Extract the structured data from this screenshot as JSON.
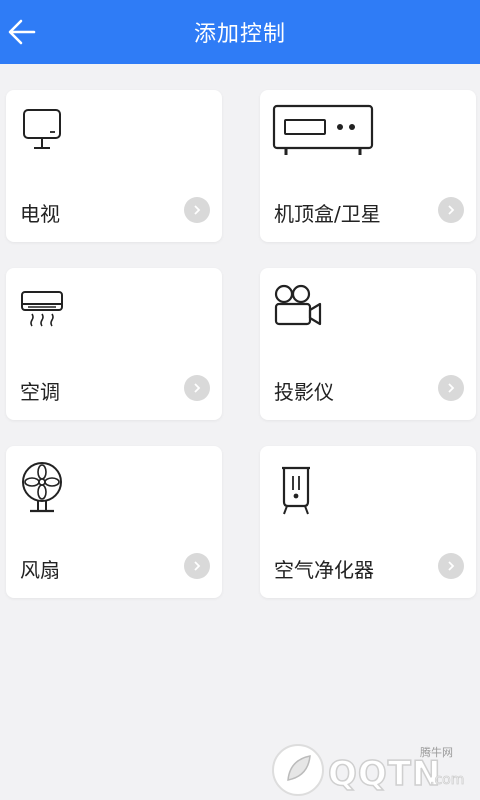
{
  "header": {
    "title": "添加控制",
    "background": "#2f7cf6"
  },
  "devices": [
    {
      "label": "电视",
      "icon": "tv-icon"
    },
    {
      "label": "机顶盒/卫星",
      "icon": "set-top-box-icon"
    },
    {
      "label": "空调",
      "icon": "air-conditioner-icon"
    },
    {
      "label": "投影仪",
      "icon": "projector-icon"
    },
    {
      "label": "风扇",
      "icon": "fan-icon"
    },
    {
      "label": "空气净化器",
      "icon": "air-purifier-icon"
    }
  ],
  "watermark": {
    "brand": "QQTN",
    "domain": ".com",
    "sub": "腾牛网"
  }
}
